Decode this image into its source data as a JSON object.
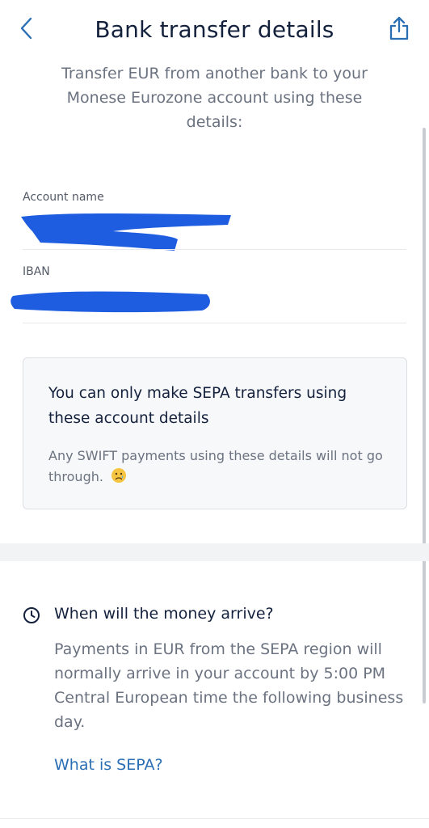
{
  "header": {
    "title": "Bank transfer details",
    "back_icon": "chevron-left-icon",
    "share_icon": "share-icon"
  },
  "subtitle": "Transfer EUR from another bank to your Monese Eurozone account using these details:",
  "fields": {
    "account_name_label": "Account name",
    "iban_label": "IBAN"
  },
  "info_card": {
    "title": "You can only make SEPA transfers using these account details",
    "body": "Any SWIFT payments using these details will not go through.",
    "emoji": "sad-face-icon"
  },
  "arrival": {
    "icon": "clock-icon",
    "heading": "When will the money arrive?",
    "body": "Payments in EUR from the SEPA region will normally arrive in your account by 5:00 PM Central European time the following business day.",
    "link": "What is SEPA?"
  },
  "colors": {
    "accent": "#2a6fb3",
    "text_primary": "#14213d",
    "text_secondary": "#6b7280",
    "redaction": "#1f5de0"
  }
}
